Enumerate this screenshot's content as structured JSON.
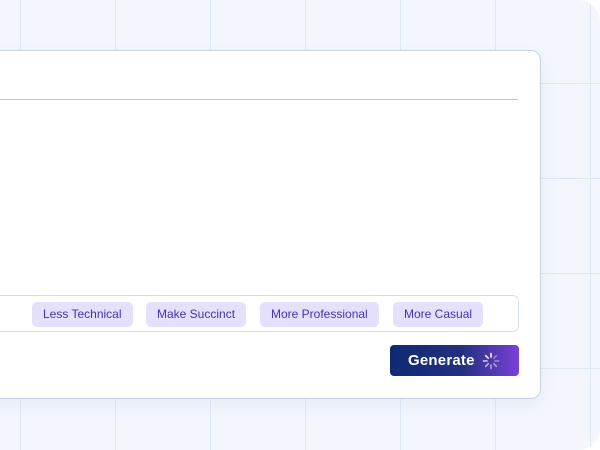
{
  "tone_options": [
    {
      "label": "Less Technical"
    },
    {
      "label": "Make Succinct"
    },
    {
      "label": "More Professional"
    },
    {
      "label": "More Casual"
    }
  ],
  "actions": {
    "generate_label": "Generate",
    "generate_icon": "loading-spinner-icon"
  },
  "colors": {
    "chip_background": "#e5e0fb",
    "chip_text": "#4a2fb3",
    "button_gradient_start": "#0f2a73",
    "button_gradient_end": "#7a40d8"
  }
}
